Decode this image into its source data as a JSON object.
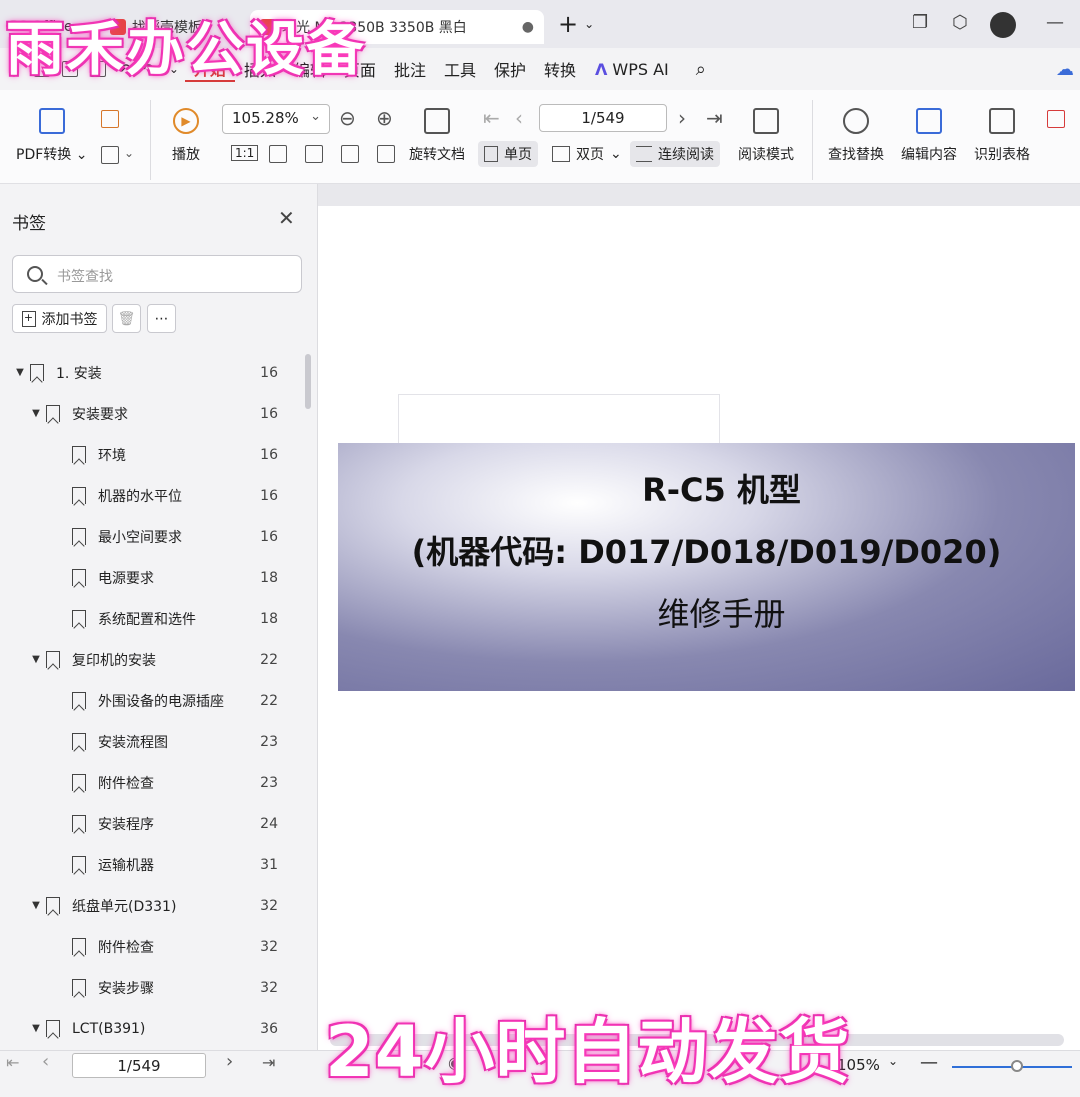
{
  "tabs": [
    {
      "label": "PS Office"
    },
    {
      "label": "找稻壳模板"
    },
    {
      "label": "理光 MP 3350B 3350B 黑白"
    }
  ],
  "menu": {
    "items": [
      "开始",
      "插入",
      "编辑",
      "页面",
      "批注",
      "工具",
      "保护",
      "转换",
      "WPS AI"
    ],
    "active": "开始"
  },
  "ribbon": {
    "pdf_convert": "PDF转换",
    "play": "播放",
    "zoom": "105.28%",
    "rotate": "旋转文档",
    "page": "1/549",
    "single": "单页",
    "double": "双页",
    "continuous": "连续阅读",
    "read_mode": "阅读模式",
    "find_replace": "查找替换",
    "edit_content": "编辑内容",
    "recognize_table": "识别表格",
    "actual_size": "1:1"
  },
  "sidebar": {
    "title": "书签",
    "search_placeholder": "书签查找",
    "add_bookmark": "添加书签",
    "bookmarks": [
      {
        "label": "1. 安装",
        "page": "16",
        "level": 0,
        "expanded": true
      },
      {
        "label": "安装要求",
        "page": "16",
        "level": 1,
        "expanded": true
      },
      {
        "label": "环境",
        "page": "16",
        "level": 2
      },
      {
        "label": "机器的水平位",
        "page": "16",
        "level": 2
      },
      {
        "label": "最小空间要求",
        "page": "16",
        "level": 2
      },
      {
        "label": "电源要求",
        "page": "18",
        "level": 2
      },
      {
        "label": "系统配置和选件",
        "page": "18",
        "level": 2
      },
      {
        "label": "复印机的安装",
        "page": "22",
        "level": 1,
        "expanded": true
      },
      {
        "label": "外围设备的电源插座",
        "page": "22",
        "level": 2
      },
      {
        "label": "安装流程图",
        "page": "23",
        "level": 2
      },
      {
        "label": "附件检查",
        "page": "23",
        "level": 2
      },
      {
        "label": "安装程序",
        "page": "24",
        "level": 2
      },
      {
        "label": "运输机器",
        "page": "31",
        "level": 2
      },
      {
        "label": "纸盘单元(D331)",
        "page": "32",
        "level": 1,
        "expanded": true
      },
      {
        "label": "附件检查",
        "page": "32",
        "level": 2
      },
      {
        "label": "安装步骤",
        "page": "32",
        "level": 2
      },
      {
        "label": "LCT(B391)",
        "page": "36",
        "level": 1,
        "expanded": true
      }
    ]
  },
  "document": {
    "title_line1": "R-C5 机型",
    "title_line2": "(机器代码: D017/D018/D019/D020)",
    "title_line3": "维修手册"
  },
  "statusbar": {
    "page": "1/549",
    "zoom": "105%"
  },
  "watermarks": {
    "top": "雨禾办公设备",
    "bottom": "24小时自动发货"
  },
  "colors": {
    "accent": "#d63b3b",
    "cover_bg": "#6a6a9c",
    "watermark_glow": "#ff3fbf"
  }
}
